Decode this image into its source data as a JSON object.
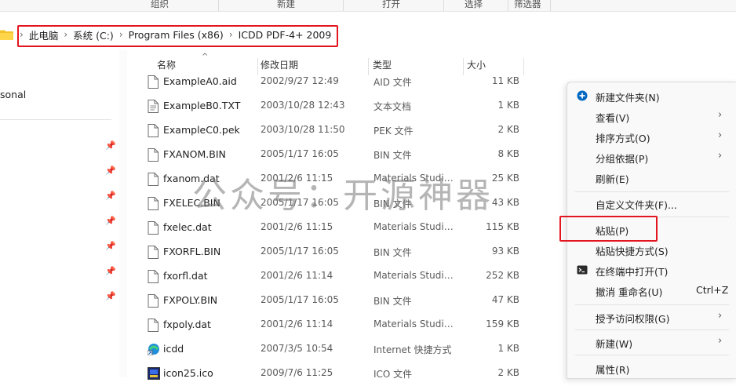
{
  "ribbon": {
    "groups": [
      "组织",
      "新建",
      "打开",
      "选择",
      "筛选器"
    ]
  },
  "address_bar": {
    "crumbs": [
      "此电脑",
      "系统 (C:)",
      "Program Files (x86)",
      "ICDD PDF-4+ 2009"
    ]
  },
  "nav": {
    "personal_label": "sonal"
  },
  "columns": {
    "name": "名称",
    "date": "修改日期",
    "type": "类型",
    "size": "大小"
  },
  "files": [
    {
      "name": "ExampleA0.aid",
      "date": "2002/9/27 12:49",
      "type": "AID 文件",
      "size": "11 KB",
      "icon": "file-icon"
    },
    {
      "name": "ExampleB0.TXT",
      "date": "2003/10/28 12:43",
      "type": "文本文档",
      "size": "1 KB",
      "icon": "text-file-icon"
    },
    {
      "name": "ExampleC0.pek",
      "date": "2003/10/28 11:50",
      "type": "PEK 文件",
      "size": "2 KB",
      "icon": "file-icon"
    },
    {
      "name": "FXANOM.BIN",
      "date": "2005/1/17 16:05",
      "type": "BIN 文件",
      "size": "8 KB",
      "icon": "file-icon"
    },
    {
      "name": "fxanom.dat",
      "date": "2001/2/6 11:15",
      "type": "Materials Studio...",
      "size": "25 KB",
      "icon": "file-icon"
    },
    {
      "name": "FXELEC.BIN",
      "date": "2005/1/17 16:05",
      "type": "BIN 文件",
      "size": "43 KB",
      "icon": "file-icon"
    },
    {
      "name": "fxelec.dat",
      "date": "2001/2/6 11:15",
      "type": "Materials Studio...",
      "size": "115 KB",
      "icon": "file-icon"
    },
    {
      "name": "FXORFL.BIN",
      "date": "2005/1/17 16:05",
      "type": "BIN 文件",
      "size": "93 KB",
      "icon": "file-icon"
    },
    {
      "name": "fxorfl.dat",
      "date": "2001/2/6 11:14",
      "type": "Materials Studio...",
      "size": "252 KB",
      "icon": "file-icon"
    },
    {
      "name": "FXPOLY.BIN",
      "date": "2005/1/17 16:05",
      "type": "BIN 文件",
      "size": "47 KB",
      "icon": "file-icon"
    },
    {
      "name": "fxpoly.dat",
      "date": "2001/2/6 11:14",
      "type": "Materials Studio...",
      "size": "159 KB",
      "icon": "file-icon"
    },
    {
      "name": "icdd",
      "date": "2007/3/5 10:54",
      "type": "Internet 快捷方式",
      "size": "1 KB",
      "icon": "internet-shortcut-icon"
    },
    {
      "name": "icon25.ico",
      "date": "2009/7/6 11:25",
      "type": "ICO 文件",
      "size": "2 KB",
      "icon": "ico-file-icon"
    }
  ],
  "watermark": "公众号：开源神器",
  "context_menu": {
    "items": [
      {
        "label": "新建文件夹(N)",
        "icon": "new-folder-icon"
      },
      {
        "label": "查看(V)",
        "submenu": true
      },
      {
        "label": "排序方式(O)",
        "submenu": true
      },
      {
        "label": "分组依据(P)",
        "submenu": true
      },
      {
        "label": "刷新(E)"
      },
      {
        "label": "自定义文件夹(F)..."
      },
      {
        "label": "粘贴(P)"
      },
      {
        "label": "粘贴快捷方式(S)"
      },
      {
        "label": "在终端中打开(T)",
        "icon": "terminal-icon"
      },
      {
        "label": "撤消 重命名(U)",
        "shortcut": "Ctrl+Z"
      },
      {
        "label": "授予访问权限(G)",
        "submenu": true
      },
      {
        "label": "新建(W)",
        "submenu": true
      },
      {
        "label": "属性(R)"
      }
    ]
  },
  "colors": {
    "highlight_box": "#e3161f",
    "accent": "#0067c0"
  }
}
